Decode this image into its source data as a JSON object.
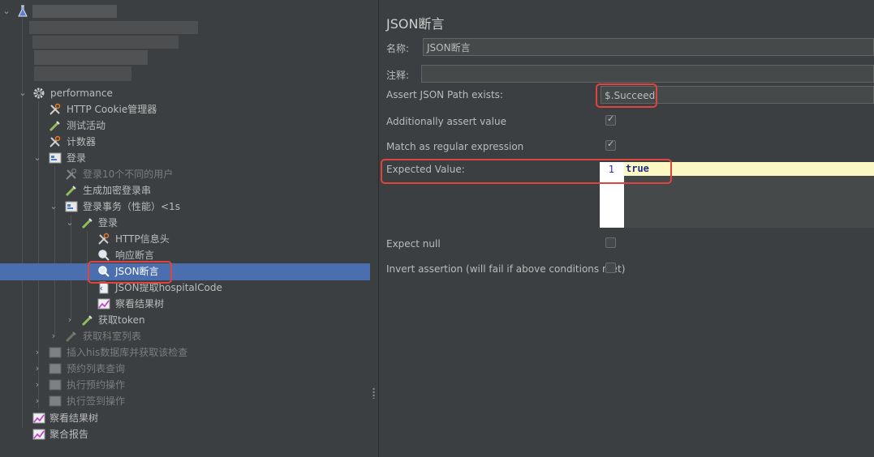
{
  "tree": {
    "root": "performance",
    "items": [
      {
        "label": "HTTP Cookie管理器"
      },
      {
        "label": "测试活动"
      },
      {
        "label": "计数器"
      },
      {
        "label": "登录"
      },
      {
        "label": "登录10个不同的用户"
      },
      {
        "label": "生成加密登录串"
      },
      {
        "label": "登录事务（性能）<1s"
      },
      {
        "label": "登录"
      },
      {
        "label": "HTTP信息头"
      },
      {
        "label": "响应断言"
      },
      {
        "label": "JSON断言"
      },
      {
        "label": "JSON提取hospitalCode"
      },
      {
        "label": "察看结果树"
      },
      {
        "label": "获取token"
      },
      {
        "label": "获取科室列表"
      },
      {
        "label": "插入his数据库并获取该检查"
      },
      {
        "label": "预约列表查询"
      },
      {
        "label": "执行预约操作"
      },
      {
        "label": "执行签到操作"
      },
      {
        "label": "察看结果树"
      },
      {
        "label": "聚合报告"
      }
    ]
  },
  "form": {
    "title": "JSON断言",
    "name_label": "名称:",
    "name_value": "JSON断言",
    "comment_label": "注释:",
    "comment_value": "",
    "assert_path_label": "Assert JSON Path exists:",
    "assert_path_value": "$.Succeed",
    "additionally_label": "Additionally assert value",
    "additionally_checked": true,
    "regex_label": "Match as regular expression",
    "regex_checked": true,
    "expected_label": "Expected Value:",
    "expected_line_no": "1",
    "expected_value": "true",
    "expect_null_label": "Expect null",
    "expect_null_checked": false,
    "invert_label": "Invert assertion (will fail if above conditions met)",
    "invert_checked": false
  },
  "colors": {
    "background": "#3c3f41",
    "selection": "#4b6eaf",
    "highlight": "#e0443e",
    "editor_line": "#fbf8c4"
  }
}
